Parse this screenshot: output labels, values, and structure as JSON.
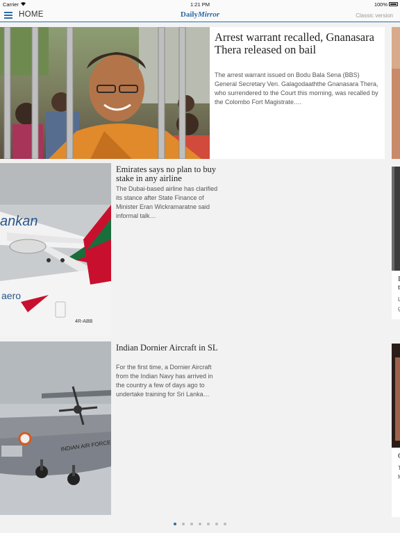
{
  "status_bar": {
    "carrier": "Carrier",
    "time": "1:21 PM",
    "battery": "100%"
  },
  "nav": {
    "home_label": "HOME",
    "logo": "Daily",
    "logo_em": "Mirror",
    "classic_version": "Classic version"
  },
  "featured": {
    "title": "Arrest warrant recalled, Gnanasara Thera released on bail",
    "summary": "The arrest warrant issued on Bodu Bala Sena (BBS) General Secretary Ven. Galagodaaththe Gnanasara Thera, who surrendered to the Court this morning, was recalled by the Colombo Fort Magistrate.…"
  },
  "stories": [
    {
      "title": "Emirates says no plan to buy stake in any airline",
      "summary": "The Dubai-based airline has clarified its stance after State Finance of Minister Eran Wickramaratne said informal talk…",
      "photo_text_1": "ankan",
      "photo_text_2": "aero",
      "photo_text_3": "4R-ABB"
    },
    {
      "title": "Indian Dornier Aircraft in SL",
      "summary": "For the first time, a Dornier Aircraft from the Indian Navy has arrived in the country a few of days ago to undertake training for Sri Lanka…",
      "photo_text": "INDIAN AIR FORCE"
    }
  ],
  "peek_cards": [
    {
      "line1": "I",
      "line2": "t",
      "line3": "L",
      "line4": "g"
    },
    {
      "line1": "C",
      "line2": "T",
      "line3": "M"
    }
  ],
  "pagination": {
    "pages": 7,
    "current": 1
  }
}
